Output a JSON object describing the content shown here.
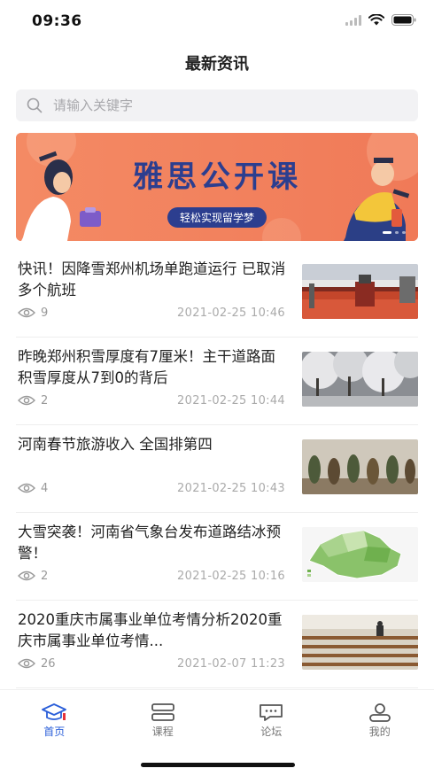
{
  "status_bar": {
    "time": "09:36"
  },
  "header": {
    "title": "最新资讯"
  },
  "search": {
    "placeholder": "请输入关键字",
    "value": ""
  },
  "banner": {
    "title": "雅思公开课",
    "subtitle": "轻松实现留学梦"
  },
  "news": [
    {
      "title": "快讯！因降雪郑州机场单跑道运行 已取消多个航班",
      "views": "9",
      "date": "2021-02-25 10:46",
      "thumb": "airport-gate-photo"
    },
    {
      "title": "昨晚郑州积雪厚度有7厘米！主干道路面积雪厚度从7到0的背后",
      "views": "2",
      "date": "2021-02-25 10:44",
      "thumb": "snowy-trees-photo"
    },
    {
      "title": "河南春节旅游收入 全国排第四",
      "views": "4",
      "date": "2021-02-25 10:43",
      "thumb": "performers-photo"
    },
    {
      "title": "大雪突袭！河南省气象台发布道路结冰预警！",
      "views": "2",
      "date": "2021-02-25 10:16",
      "thumb": "weather-map"
    },
    {
      "title": "2020重庆市属事业单位考情分析2020重庆市属事业单位考情...",
      "views": "26",
      "date": "2021-02-07 11:23",
      "thumb": "exam-hall-photo"
    }
  ],
  "tabs": [
    {
      "label": "首页",
      "icon": "graduation-cap-icon",
      "active": true
    },
    {
      "label": "课程",
      "icon": "course-icon",
      "active": false
    },
    {
      "label": "论坛",
      "icon": "forum-icon",
      "active": false
    },
    {
      "label": "我的",
      "icon": "profile-icon",
      "active": false
    }
  ],
  "colors": {
    "accent": "#2b5fd9",
    "banner_bg": "#f08a62",
    "banner_text": "#2c3e8f"
  }
}
